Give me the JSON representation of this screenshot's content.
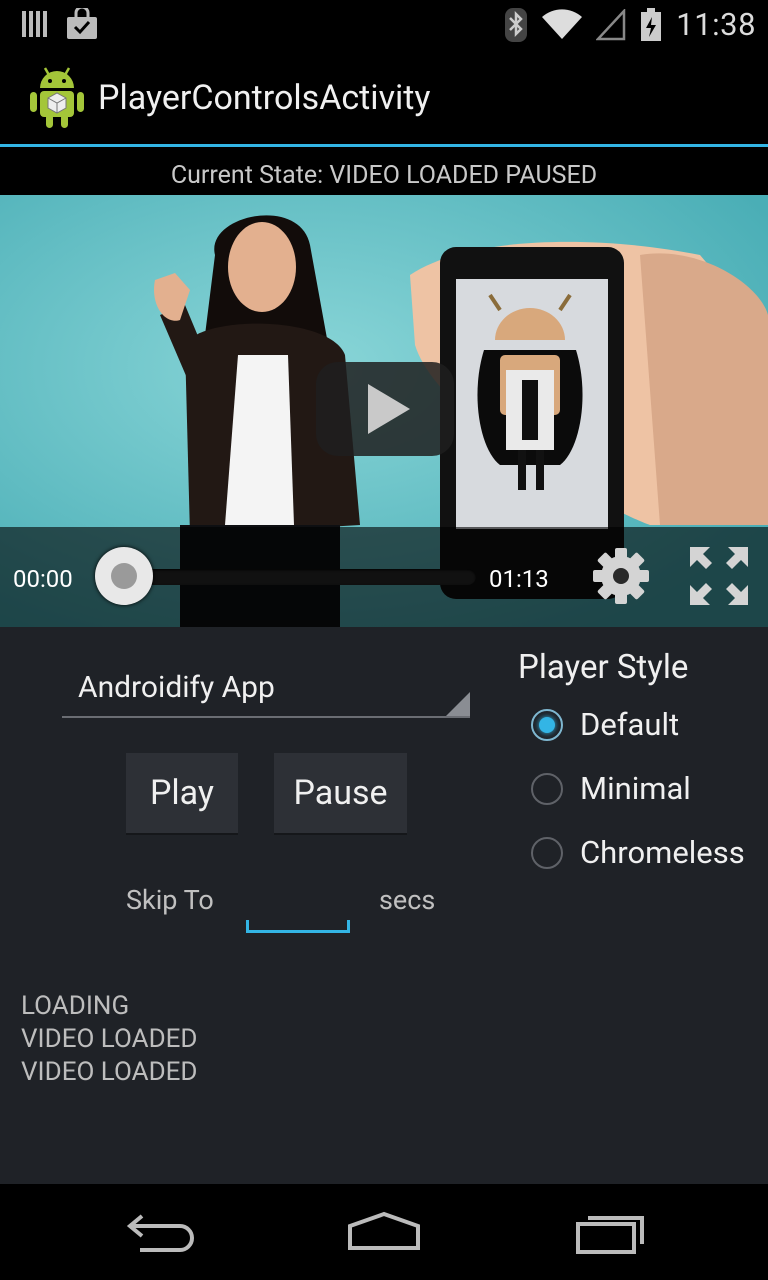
{
  "status_bar": {
    "time": "11:38",
    "left_icons": [
      "library-icon",
      "shopping-bag-check-icon"
    ],
    "right_icons": [
      "bluetooth-icon",
      "wifi-icon",
      "cell-signal-icon",
      "battery-icon"
    ]
  },
  "action_bar": {
    "title": "PlayerControlsActivity",
    "icon": "android-app-icon",
    "accent_color": "#33b5e5"
  },
  "state": {
    "text": "Current State: VIDEO LOADED PAUSED"
  },
  "video": {
    "current_time": "00:00",
    "duration": "01:13",
    "progress": 0,
    "icons": [
      "play-icon",
      "settings-gear-icon",
      "fullscreen-icon"
    ]
  },
  "video_select": {
    "selected": "Androidify App"
  },
  "buttons": {
    "play": "Play",
    "pause": "Pause"
  },
  "skip": {
    "label": "Skip To",
    "value": "",
    "unit": "secs"
  },
  "player_style": {
    "title": "Player Style",
    "options": [
      {
        "label": "Default",
        "checked": true
      },
      {
        "label": "Minimal",
        "checked": false
      },
      {
        "label": "Chromeless",
        "checked": false
      }
    ]
  },
  "log": [
    "LOADING",
    "VIDEO LOADED",
    "VIDEO LOADED"
  ],
  "nav_bar": {
    "icons": [
      "back-icon",
      "home-icon",
      "recent-apps-icon"
    ]
  }
}
